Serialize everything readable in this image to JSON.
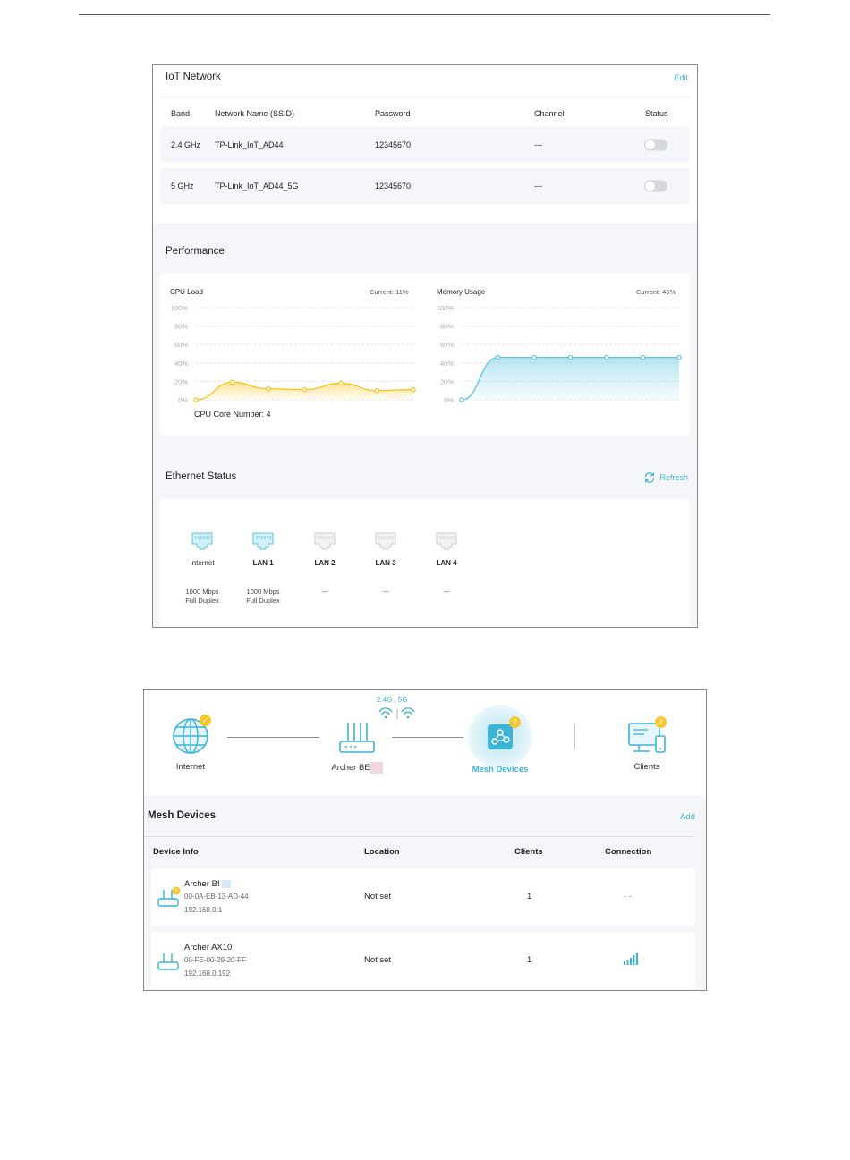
{
  "iot": {
    "title": "IoT Network",
    "edit_label": "Edit",
    "columns": {
      "band": "Band",
      "ssid": "Network Name (SSID)",
      "password": "Password",
      "channel": "Channel",
      "status": "Status"
    },
    "rows": [
      {
        "band": "2.4 GHz",
        "ssid": "TP-Link_IoT_AD44",
        "password": "12345670",
        "channel": "---",
        "enabled": false
      },
      {
        "band": "5 GHz",
        "ssid": "TP-Link_IoT_AD44_5G",
        "password": "12345670",
        "channel": "---",
        "enabled": false
      }
    ]
  },
  "performance": {
    "title": "Performance",
    "cpu": {
      "label": "CPU Load",
      "current": "Current: 11%",
      "core_text": "CPU Core Number: 4"
    },
    "memory": {
      "label": "Memory Usage",
      "current": "Current: 46%"
    }
  },
  "chart_data": [
    {
      "type": "area",
      "title": "CPU Load",
      "yticks": [
        "100%",
        "80%",
        "60%",
        "40%",
        "20%",
        "0%"
      ],
      "ylim": [
        0,
        100
      ],
      "x": [
        1,
        2,
        3,
        4,
        5,
        6,
        7
      ],
      "values": [
        0,
        19,
        12,
        11,
        18,
        10,
        11
      ],
      "color": "#f5c518"
    },
    {
      "type": "area",
      "title": "Memory Usage",
      "yticks": [
        "100%",
        "80%",
        "60%",
        "40%",
        "20%",
        "0%"
      ],
      "ylim": [
        0,
        100
      ],
      "x": [
        1,
        2,
        3,
        4,
        5,
        6,
        7
      ],
      "values": [
        0,
        46,
        46,
        46,
        46,
        46,
        46
      ],
      "color": "#5ec6e0"
    }
  ],
  "ethernet": {
    "title": "Ethernet Status",
    "refresh_label": "Refresh",
    "ports": [
      {
        "name": "Internet",
        "connected": true,
        "speed1": "1000 Mbps",
        "speed2": "Full Duplex"
      },
      {
        "name": "LAN 1",
        "connected": true,
        "speed1": "1000 Mbps",
        "speed2": "Full Duplex"
      },
      {
        "name": "LAN 2",
        "connected": false,
        "speed1": "---",
        "speed2": ""
      },
      {
        "name": "LAN 3",
        "connected": false,
        "speed1": "---",
        "speed2": ""
      },
      {
        "name": "LAN 4",
        "connected": false,
        "speed1": "---",
        "speed2": ""
      }
    ]
  },
  "topology": {
    "internet_label": "Internet",
    "router_label": "Archer BE",
    "band_24": "2.4G",
    "band_5": "5G",
    "mesh_label": "Mesh Devices",
    "mesh_badge": "2",
    "clients_label": "Clients",
    "clients_badge": "2"
  },
  "mesh": {
    "title": "Mesh Devices",
    "add_label": "Add",
    "columns": {
      "info": "Device Info",
      "location": "Location",
      "clients": "Clients",
      "connection": "Connection"
    },
    "rows": [
      {
        "name": "Archer BI",
        "mac": "00-0A-EB-13-AD-44",
        "ip": "192.168.0.1",
        "location": "Not set",
        "clients": "1",
        "connection": "- -"
      },
      {
        "name": "Archer AX10",
        "mac": "00-FE-00-29-20-FF",
        "ip": "192.168.0.192",
        "location": "Not set",
        "clients": "1",
        "connection": ""
      }
    ]
  },
  "colors": {
    "accent": "#3cb4d6",
    "badge": "#f7c72b",
    "cpu": "#f5c518",
    "memory": "#5ec6e0"
  },
  "icons": [
    "globe-icon",
    "router-icon",
    "wifi-icon",
    "mesh-icon",
    "clients-icon",
    "ethernet-port-icon",
    "refresh-icon",
    "signal-icon",
    "check-icon"
  ]
}
